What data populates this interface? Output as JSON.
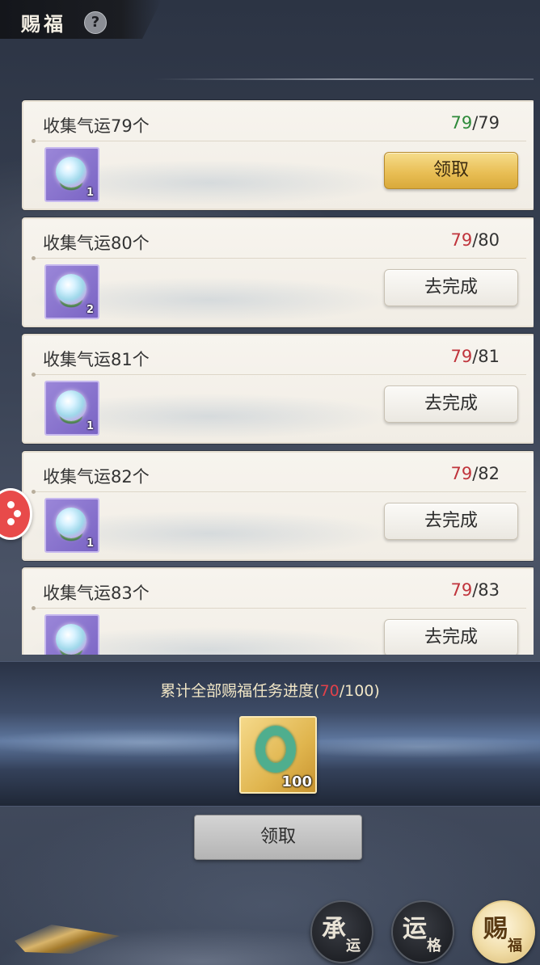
{
  "header": {
    "title": "赐福",
    "help_icon": "?"
  },
  "tasks": [
    {
      "title": "收集气运79个",
      "current": "79",
      "total": "/79",
      "status": "complete",
      "reward_icon": "orb-icon",
      "reward_count": "1",
      "action": "领取"
    },
    {
      "title": "收集气运80个",
      "current": "79",
      "total": "/80",
      "status": "incomplete",
      "reward_icon": "orb-icon",
      "reward_count": "2",
      "action": "去完成"
    },
    {
      "title": "收集气运81个",
      "current": "79",
      "total": "/81",
      "status": "incomplete",
      "reward_icon": "orb-icon",
      "reward_count": "1",
      "action": "去完成"
    },
    {
      "title": "收集气运82个",
      "current": "79",
      "total": "/82",
      "status": "incomplete",
      "reward_icon": "orb-icon",
      "reward_count": "1",
      "action": "去完成"
    },
    {
      "title": "收集气运83个",
      "current": "79",
      "total": "/83",
      "status": "incomplete",
      "reward_icon": "orb-icon",
      "reward_count": "",
      "action": "去完成"
    }
  ],
  "total_progress": {
    "prefix": "累计全部赐福任务进度(",
    "current": "70",
    "suffix": "/100)",
    "reward_icon": "jade-ring-icon",
    "reward_count": "100",
    "claim_label": "领取"
  },
  "nav": {
    "tabs": [
      {
        "big": "承",
        "small": "运"
      },
      {
        "big": "运",
        "small": "格"
      },
      {
        "big": "赐",
        "small": "福"
      }
    ],
    "active_index": 2
  },
  "colors": {
    "progress_complete": "#2e8a3a",
    "progress_incomplete": "#c0343c",
    "gold_button": "#e9bf56",
    "total_current": "#e0414a"
  }
}
